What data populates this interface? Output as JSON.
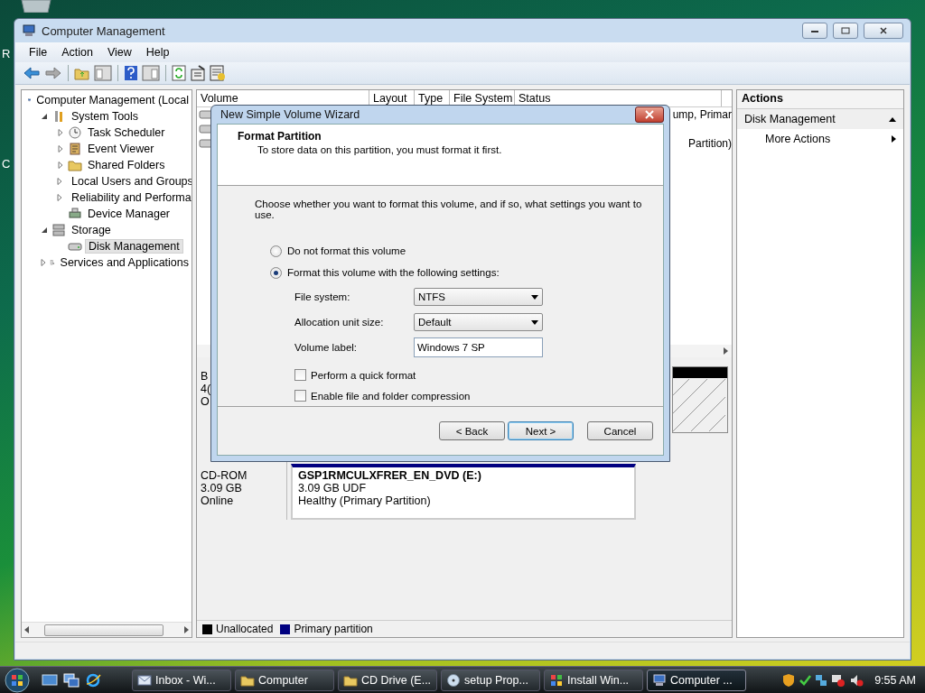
{
  "desktop": {
    "labels": [
      "R",
      "C"
    ]
  },
  "window": {
    "title": "Computer Management"
  },
  "menu": [
    "File",
    "Action",
    "View",
    "Help"
  ],
  "tree": [
    {
      "label": "Computer Management (Local",
      "selected": false,
      "children": [
        {
          "label": "System Tools",
          "expanded": true,
          "selected": false,
          "children": [
            {
              "label": "Task Scheduler",
              "expanded": false,
              "selected": false
            },
            {
              "label": "Event Viewer",
              "expanded": false,
              "selected": false
            },
            {
              "label": "Shared Folders",
              "expanded": false,
              "selected": false
            },
            {
              "label": "Local Users and Groups",
              "expanded": false,
              "selected": false
            },
            {
              "label": "Reliability and Performa",
              "expanded": false,
              "selected": false
            },
            {
              "label": "Device Manager",
              "selected": false
            }
          ]
        },
        {
          "label": "Storage",
          "expanded": true,
          "selected": false,
          "children": [
            {
              "label": "Disk Management",
              "selected": true
            }
          ]
        },
        {
          "label": "Services and Applications",
          "expanded": false,
          "selected": false
        }
      ]
    }
  ],
  "table": {
    "columns": [
      "Volume",
      "Layout",
      "Type",
      "File System",
      "Status"
    ],
    "rows": [
      {
        "status": "ump, Primar"
      },
      {},
      {
        "status": "Partition)"
      }
    ]
  },
  "disks": [
    {
      "lines": [
        "B",
        "4(",
        "O"
      ]
    },
    {
      "lines": [
        "CD-ROM",
        "3.09 GB",
        "Online"
      ],
      "volume": {
        "name": "GSP1RMCULXFRER_EN_DVD  (E:)",
        "size": "3.09 GB UDF",
        "status": "Healthy (Primary Partition)"
      }
    }
  ],
  "legend": [
    {
      "label": "Unallocated",
      "color": "#000000"
    },
    {
      "label": "Primary partition",
      "color": "#000080"
    }
  ],
  "actions": {
    "title": "Actions",
    "items": [
      {
        "label": "Disk Management",
        "kind": "section"
      },
      {
        "label": "More Actions",
        "kind": "item"
      }
    ]
  },
  "dialog": {
    "title": "New Simple Volume Wizard",
    "heading": "Format Partition",
    "subheading": "To store data on this partition, you must format it first.",
    "prompt": "Choose whether you want to format this volume, and if so, what settings you want to use.",
    "radios": [
      {
        "label": "Do not format this volume",
        "selected": false
      },
      {
        "label": "Format this volume with the following settings:",
        "selected": true
      }
    ],
    "fields": [
      {
        "label": "File system:",
        "kind": "dropdown",
        "value": "NTFS"
      },
      {
        "label": "Allocation unit size:",
        "kind": "dropdown",
        "value": "Default"
      },
      {
        "label": "Volume label:",
        "kind": "text",
        "value": "Windows 7 SP"
      }
    ],
    "checkboxes": [
      {
        "label": "Perform a quick format",
        "checked": false
      },
      {
        "label": "Enable file and folder compression",
        "checked": false
      }
    ],
    "buttons": [
      {
        "label": "< Back",
        "default": false
      },
      {
        "label": "Next >",
        "default": true
      },
      {
        "label": "Cancel",
        "default": false
      }
    ]
  },
  "taskbar": {
    "tasks": [
      {
        "label": "Inbox - Wi...",
        "selected": false
      },
      {
        "label": "Computer",
        "selected": false
      },
      {
        "label": "CD Drive (E...",
        "selected": false
      },
      {
        "label": "setup Prop...",
        "selected": false
      },
      {
        "label": "Install Win...",
        "selected": false
      },
      {
        "label": "Computer ...",
        "selected": true
      }
    ],
    "clock": "9:55 AM"
  }
}
